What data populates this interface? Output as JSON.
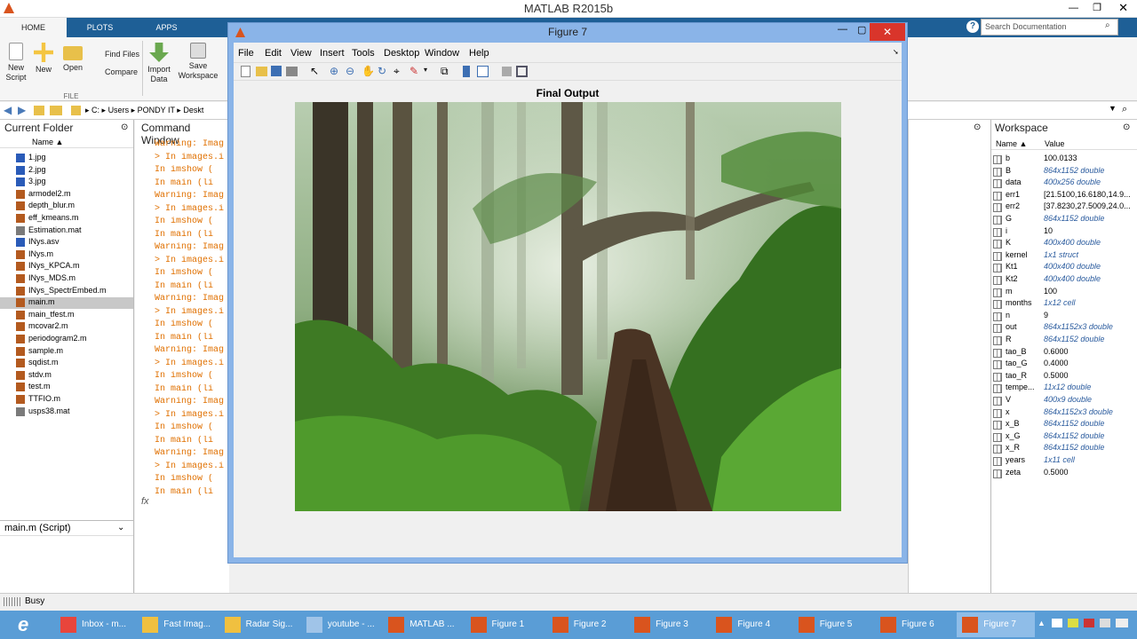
{
  "app_title": "MATLAB R2015b",
  "ribbon_tabs": [
    "HOME",
    "PLOTS",
    "APPS"
  ],
  "ribbon": {
    "new_script": "New\nScript",
    "new": "New",
    "open": "Open",
    "find_files": "Find Files",
    "compare": "Compare",
    "import_data": "Import\nData",
    "save_workspace": "Save\nWorkspace",
    "file_group": "FILE"
  },
  "search_placeholder": "Search Documentation",
  "address": [
    "C:",
    "Users",
    "PONDY IT",
    "Deskt"
  ],
  "current_folder": {
    "title": "Current Folder",
    "column": "Name ▲",
    "files": [
      {
        "name": "1.jpg",
        "type": "img"
      },
      {
        "name": "2.jpg",
        "type": "img"
      },
      {
        "name": "3.jpg",
        "type": "img"
      },
      {
        "name": "armodel2.m",
        "type": "m"
      },
      {
        "name": "depth_blur.m",
        "type": "m"
      },
      {
        "name": "eff_kmeans.m",
        "type": "m"
      },
      {
        "name": "Estimation.mat",
        "type": "mat"
      },
      {
        "name": "INys.asv",
        "type": "asv"
      },
      {
        "name": "INys.m",
        "type": "m"
      },
      {
        "name": "INys_KPCA.m",
        "type": "m"
      },
      {
        "name": "INys_MDS.m",
        "type": "m"
      },
      {
        "name": "INys_SpectrEmbed.m",
        "type": "m"
      },
      {
        "name": "main.m",
        "type": "m",
        "selected": true
      },
      {
        "name": "main_tfest.m",
        "type": "m"
      },
      {
        "name": "mcovar2.m",
        "type": "m"
      },
      {
        "name": "periodogram2.m",
        "type": "m"
      },
      {
        "name": "sample.m",
        "type": "m"
      },
      {
        "name": "sqdist.m",
        "type": "m"
      },
      {
        "name": "stdv.m",
        "type": "m"
      },
      {
        "name": "test.m",
        "type": "m"
      },
      {
        "name": "TTFIO.m",
        "type": "m"
      },
      {
        "name": "usps38.mat",
        "type": "mat"
      }
    ],
    "details": "main.m  (Script)"
  },
  "command_window": {
    "title": "Command Window",
    "lines": [
      "Warning: Imag",
      "> In images.i",
      "  In imshow (",
      "  In main (li",
      "Warning: Imag",
      "> In images.i",
      "  In imshow (",
      "  In main (li",
      "Warning: Imag",
      "> In images.i",
      "  In imshow (",
      "  In main (li",
      "Warning: Imag",
      "> In images.i",
      "  In imshow (",
      "  In main (li",
      "Warning: Imag",
      "> In images.i",
      "  In imshow (",
      "  In main (li",
      "Warning: Imag",
      "> In images.i",
      "  In imshow (",
      "  In main (li",
      "Warning: Imag",
      "> In images.i",
      "  In imshow (",
      "  In main (li"
    ],
    "prompt": "fx"
  },
  "workspace": {
    "title": "Workspace",
    "col_name": "Name ▲",
    "col_value": "Value",
    "vars": [
      {
        "n": "b",
        "v": "100.0133",
        "it": false
      },
      {
        "n": "B",
        "v": "864x1152 double",
        "it": true
      },
      {
        "n": "data",
        "v": "400x256 double",
        "it": true
      },
      {
        "n": "err1",
        "v": "[21.5100,16.6180,14.9...",
        "it": false
      },
      {
        "n": "err2",
        "v": "[37.8230,27.5009,24.0...",
        "it": false
      },
      {
        "n": "G",
        "v": "864x1152 double",
        "it": true
      },
      {
        "n": "i",
        "v": "10",
        "it": false
      },
      {
        "n": "K",
        "v": "400x400 double",
        "it": true
      },
      {
        "n": "kernel",
        "v": "1x1 struct",
        "it": true
      },
      {
        "n": "Kt1",
        "v": "400x400 double",
        "it": true
      },
      {
        "n": "Kt2",
        "v": "400x400 double",
        "it": true
      },
      {
        "n": "m",
        "v": "100",
        "it": false
      },
      {
        "n": "months",
        "v": "1x12 cell",
        "it": true
      },
      {
        "n": "n",
        "v": "9",
        "it": false
      },
      {
        "n": "out",
        "v": "864x1152x3 double",
        "it": true
      },
      {
        "n": "R",
        "v": "864x1152 double",
        "it": true
      },
      {
        "n": "tao_B",
        "v": "0.6000",
        "it": false
      },
      {
        "n": "tao_G",
        "v": "0.4000",
        "it": false
      },
      {
        "n": "tao_R",
        "v": "0.5000",
        "it": false
      },
      {
        "n": "tempe...",
        "v": "11x12 double",
        "it": true
      },
      {
        "n": "V",
        "v": "400x9 double",
        "it": true
      },
      {
        "n": "x",
        "v": "864x1152x3 double",
        "it": true
      },
      {
        "n": "x_B",
        "v": "864x1152 double",
        "it": true
      },
      {
        "n": "x_G",
        "v": "864x1152 double",
        "it": true
      },
      {
        "n": "x_R",
        "v": "864x1152 double",
        "it": true
      },
      {
        "n": "years",
        "v": "1x11 cell",
        "it": true
      },
      {
        "n": "zeta",
        "v": "0.5000",
        "it": false
      }
    ]
  },
  "figure": {
    "title": "Figure 7",
    "menus": [
      "File",
      "Edit",
      "View",
      "Insert",
      "Tools",
      "Desktop",
      "Window",
      "Help"
    ],
    "plot_title": "Final Output"
  },
  "status": "Busy",
  "taskbar": [
    {
      "label": "Inbox - m...",
      "color": "#e8453c"
    },
    {
      "label": "Fast Imag...",
      "color": "#f0c040"
    },
    {
      "label": "Radar Sig...",
      "color": "#f0c040"
    },
    {
      "label": "youtube - ...",
      "color": "#a0c4e8"
    },
    {
      "label": "MATLAB ...",
      "color": "#d9541e"
    },
    {
      "label": "Figure 1",
      "color": "#d9541e"
    },
    {
      "label": "Figure 2",
      "color": "#d9541e"
    },
    {
      "label": "Figure 3",
      "color": "#d9541e"
    },
    {
      "label": "Figure 4",
      "color": "#d9541e"
    },
    {
      "label": "Figure 5",
      "color": "#d9541e"
    },
    {
      "label": "Figure 6",
      "color": "#d9541e"
    },
    {
      "label": "Figure 7",
      "color": "#d9541e",
      "active": true
    }
  ]
}
